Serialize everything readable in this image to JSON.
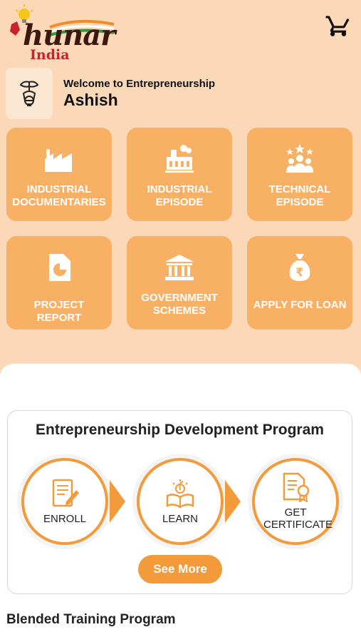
{
  "header": {
    "logo_text": "hunar",
    "logo_sub": "India",
    "cart_icon": "cart-icon"
  },
  "welcome": {
    "greeting": "Welcome to Entrepreneurship",
    "name": "Ashish",
    "icon": "sprout-bulb-icon"
  },
  "tiles": [
    {
      "label": "INDUSTRIAL DOCUMENTARIES",
      "icon": "factory-icon"
    },
    {
      "label": "INDUSTRIAL EPISODE",
      "icon": "industry-icon"
    },
    {
      "label": "TECHNICAL EPISODE",
      "icon": "team-stars-icon"
    },
    {
      "label": "PROJECT REPORT",
      "icon": "report-chart-icon"
    },
    {
      "label": "GOVERNMENT SCHEMES",
      "icon": "government-building-icon"
    },
    {
      "label": "APPLY FOR LOAN",
      "icon": "money-bag-icon"
    }
  ],
  "program": {
    "title": "Entrepreneurship Development Program",
    "steps": [
      {
        "label": "ENROLL",
        "icon": "enroll-form-icon"
      },
      {
        "label": "LEARN",
        "icon": "learn-book-icon"
      },
      {
        "label": "GET CERTIFICATE",
        "icon": "certificate-icon"
      }
    ],
    "see_more": "See More"
  },
  "blended": {
    "title": "Blended Training Program"
  },
  "colors": {
    "background": "#fad8b8",
    "tile": "#f8b065",
    "accent": "#f39a3b"
  }
}
